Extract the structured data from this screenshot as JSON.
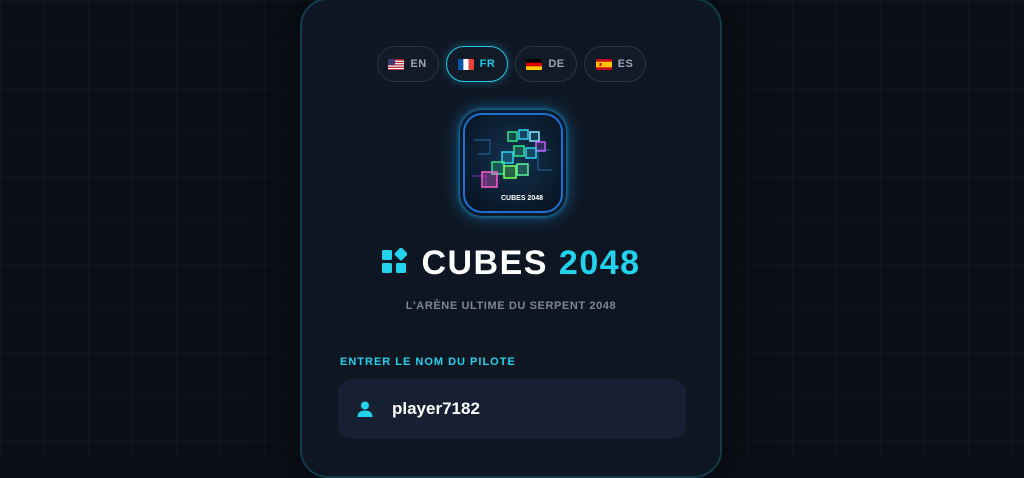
{
  "languages": [
    {
      "code": "EN",
      "flag": "us-flag",
      "active": false
    },
    {
      "code": "FR",
      "flag": "fr-flag",
      "active": true
    },
    {
      "code": "DE",
      "flag": "de-flag",
      "active": false
    },
    {
      "code": "ES",
      "flag": "es-flag",
      "active": false
    }
  ],
  "logo": {
    "caption": "CUBES 2048"
  },
  "title": {
    "part1": "CUBES",
    "part2": "2048",
    "icon": "blocks-icon"
  },
  "subtitle": "L'ARÈNE ULTIME DU SERPENT 2048",
  "pilot": {
    "label": "ENTRER LE NOM DU PILOTE",
    "value": "player7182",
    "icon": "user-icon"
  },
  "colors": {
    "accent": "#22d3ee",
    "background": "#0b0f17",
    "card": "#0f1724",
    "input": "#172033"
  }
}
